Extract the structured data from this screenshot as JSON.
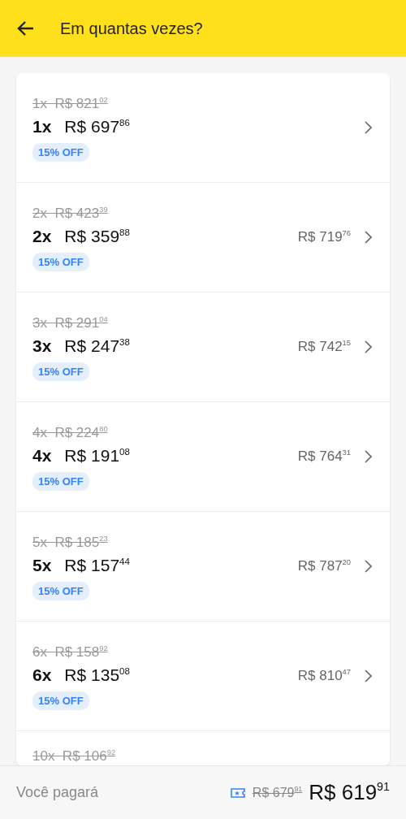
{
  "header": {
    "title": "Em quantas vezes?"
  },
  "options": [
    {
      "old_price": "1x  R$ 821$^{02}$",
      "count": "1x",
      "price": "R$ 697$^{86}$",
      "badge": "15% OFF"
    },
    {
      "old_price": "2x  R$ 423$^{39}$",
      "count": "2x",
      "price": "R$ 359$^{88}$",
      "badge": "15% OFF",
      "total": "R$ 719$^{76}$"
    },
    {
      "old_price": "3x  R$ 291$^{04}$",
      "count": "3x",
      "price": "R$ 247$^{38}$",
      "badge": "15% OFF",
      "total": "R$ 742$^{15}$"
    },
    {
      "old_price": "4x  R$ 224$^{80}$",
      "count": "4x",
      "price": "R$ 191$^{08}$",
      "badge": "15% OFF",
      "total": "R$ 764$^{31}$"
    },
    {
      "old_price": "5x  R$ 185$^{23}$",
      "count": "5x",
      "price": "R$ 157$^{44}$",
      "badge": "15% OFF",
      "total": "R$ 787$^{20}$"
    },
    {
      "old_price": "6x  R$ 158$^{92}$",
      "count": "6x",
      "price": "R$ 135$^{08}$",
      "badge": "15% OFF",
      "total": "R$ 810$^{47}$"
    },
    {
      "old_price": "10x  R$ 106$^{92}$"
    }
  ],
  "footer": {
    "label": "Você pagará",
    "old_total": "R$ 679$^{91}$",
    "total": "R$ 619$^{91}$"
  }
}
